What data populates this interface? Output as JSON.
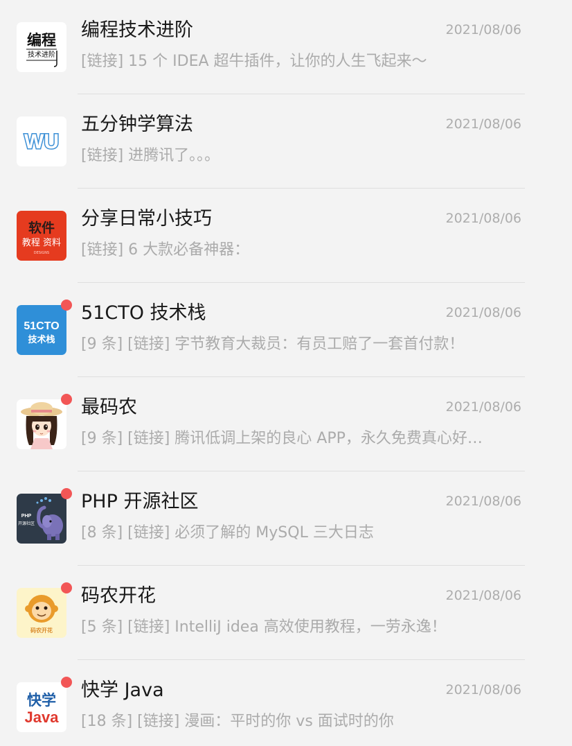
{
  "conversations": [
    {
      "name": "编程技术进阶",
      "date": "2021/08/06",
      "preview": "[链接] 15 个 IDEA 超牛插件，让你的人生飞起来～",
      "unread": false,
      "avatar": {
        "icon": "biancheng-logo",
        "line1": "编程",
        "line2": "技术进阶"
      }
    },
    {
      "name": "五分钟学算法",
      "date": "2021/08/06",
      "preview": "[链接] 进腾讯了。。。",
      "unread": false,
      "avatar": {
        "icon": "wu-logo",
        "line1": "WU"
      }
    },
    {
      "name": "分享日常小技巧",
      "date": "2021/08/06",
      "preview": "[链接] 6 大款必备神器：",
      "unread": false,
      "avatar": {
        "icon": "ruanjian-logo",
        "line1": "软件",
        "line2": "教程 资料",
        "line3": "DESIGNS"
      }
    },
    {
      "name": "51CTO 技术栈",
      "date": "2021/08/06",
      "preview": "[9 条] [链接] 字节教育大裁员：有员工赔了一套首付款！",
      "unread": true,
      "avatar": {
        "icon": "51cto-logo",
        "line1": "51CTO",
        "line2": "技术栈"
      }
    },
    {
      "name": "最码农",
      "date": "2021/08/06",
      "preview": "[9 条] [链接] 腾讯低调上架的良心 APP，永久免费真心好…",
      "unread": true,
      "avatar": {
        "icon": "girl-avatar"
      }
    },
    {
      "name": "PHP 开源社区",
      "date": "2021/08/06",
      "preview": "[8 条] [链接] 必须了解的 MySQL 三大日志",
      "unread": true,
      "avatar": {
        "icon": "elephant-logo",
        "line1": "PHP",
        "line2": "开源社区"
      }
    },
    {
      "name": "码农开花",
      "date": "2021/08/06",
      "preview": "[5 条] [链接] IntelliJ idea 高效使用教程，一劳永逸！",
      "unread": true,
      "avatar": {
        "icon": "monkey-logo",
        "line1": "码农开花"
      }
    },
    {
      "name": "快学 Java",
      "date": "2021/08/06",
      "preview": "[18 条] [链接] 漫画：平时的你 vs 面试时的你",
      "unread": true,
      "avatar": {
        "icon": "kuaixue-logo",
        "line1": "快学",
        "line2": "Java"
      }
    }
  ],
  "colors": {
    "background": "#f3f3f3",
    "unread_dot": "#f25656",
    "title": "#191919",
    "secondary_text": "#ababab"
  }
}
